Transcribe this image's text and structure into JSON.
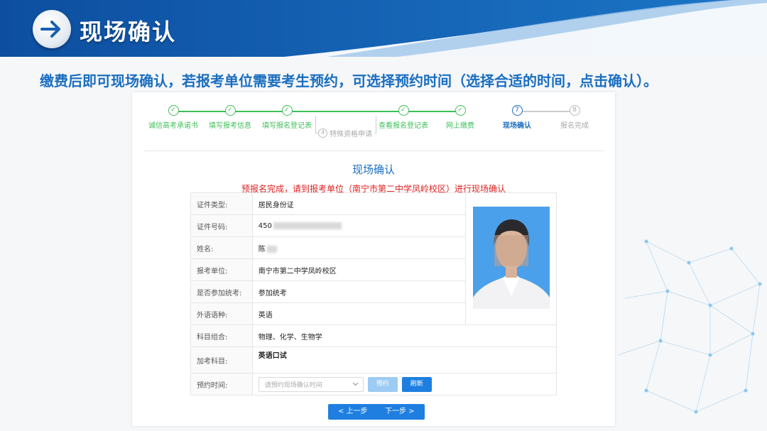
{
  "header": {
    "title": "现场确认"
  },
  "instruction": "缴费后即可现场确认，若报考单位需要考生预约，可选择预约时间（选择合适的时间，点击确认）。",
  "steps": [
    {
      "label": "诚信高考承诺书",
      "state": "done"
    },
    {
      "label": "填写报考信息",
      "state": "done"
    },
    {
      "label": "填写报名登记表",
      "state": "done"
    },
    {
      "label": "查看报名登记表",
      "state": "done"
    },
    {
      "label": "网上缴费",
      "state": "done"
    },
    {
      "label": "现场确认",
      "number": "7",
      "state": "current"
    },
    {
      "label": "报名完成",
      "number": "8",
      "state": "pending"
    }
  ],
  "branch_step": {
    "number": "4",
    "label": "特殊资格申请"
  },
  "form": {
    "title": "现场确认",
    "notice": "预报名完成，请到报考单位（南宁市第二中学凤岭校区）进行现场确认",
    "rows": {
      "id_type": {
        "label": "证件类型:",
        "value": "居民身份证"
      },
      "id_number": {
        "label": "证件号码:",
        "value": "450"
      },
      "name": {
        "label": "姓名:",
        "value": "陈"
      },
      "unit": {
        "label": "报考单位:",
        "value": "南宁市第二中学凤岭校区"
      },
      "unified_exam": {
        "label": "是否参加统考:",
        "value": "参加统考"
      },
      "language": {
        "label": "外语语种:",
        "value": "英语"
      },
      "subjects": {
        "label": "科目组合:",
        "value": "物理、化学、生物学"
      },
      "extra": {
        "label": "加考科目:",
        "value": "英语口试"
      },
      "appointment": {
        "label": "预约时间:",
        "placeholder": "请预约现场确认时间",
        "reserve_button": "预约",
        "refresh_button": "刷新"
      }
    },
    "prev_button": "< 上一步",
    "next_button": "下一步 >"
  },
  "colors": {
    "brand_blue": "#1a6ec0",
    "done_green": "#3fbf58",
    "notice_red": "#e02020",
    "button_blue": "#1e7fe0"
  },
  "icons": {
    "title": "arrow-right-icon",
    "step_done": "check-icon",
    "select": "chevron-down-icon"
  }
}
